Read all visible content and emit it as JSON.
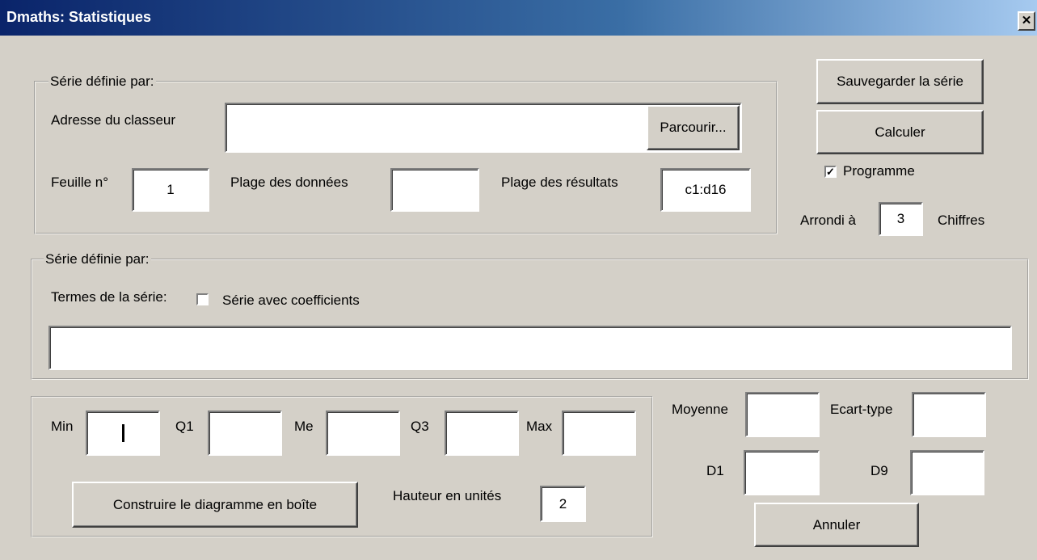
{
  "window": {
    "title": "Dmaths: Statistiques",
    "close_glyph": "✕"
  },
  "group1": {
    "legend": "Série définie par:",
    "address_label": "Adresse du classeur",
    "address_value": "",
    "browse_button": "Parcourir...",
    "sheet_label": "Feuille n°",
    "sheet_value": "1",
    "data_range_label": "Plage des données",
    "data_range_value": "",
    "result_range_label": "Plage des résultats",
    "result_range_value": "c1:d16"
  },
  "right_panel": {
    "save_button": "Sauvegarder la série",
    "calc_button": "Calculer",
    "program_checkbox_label": "Programme",
    "program_checked": true,
    "round_label": "Arrondi à",
    "round_value": "3",
    "digits_label": "Chiffres"
  },
  "group2": {
    "legend": "Série définie par:",
    "terms_label": "Termes de la série:",
    "coeff_checkbox_label": "Série avec coefficients",
    "coeff_checked": false,
    "terms_value": ""
  },
  "stats": {
    "min_label": "Min",
    "min_value": "",
    "q1_label": "Q1",
    "q1_value": "",
    "me_label": "Me",
    "me_value": "",
    "q3_label": "Q3",
    "q3_value": "",
    "max_label": "Max",
    "max_value": "",
    "build_button": "Construire le diagramme en boîte",
    "height_label": "Hauteur en unités",
    "height_value": "2"
  },
  "results": {
    "mean_label": "Moyenne",
    "mean_value": "",
    "std_label": "Ecart-type",
    "std_value": "",
    "d1_label": "D1",
    "d1_value": "",
    "d9_label": "D9",
    "d9_value": "",
    "cancel_button": "Annuler"
  }
}
